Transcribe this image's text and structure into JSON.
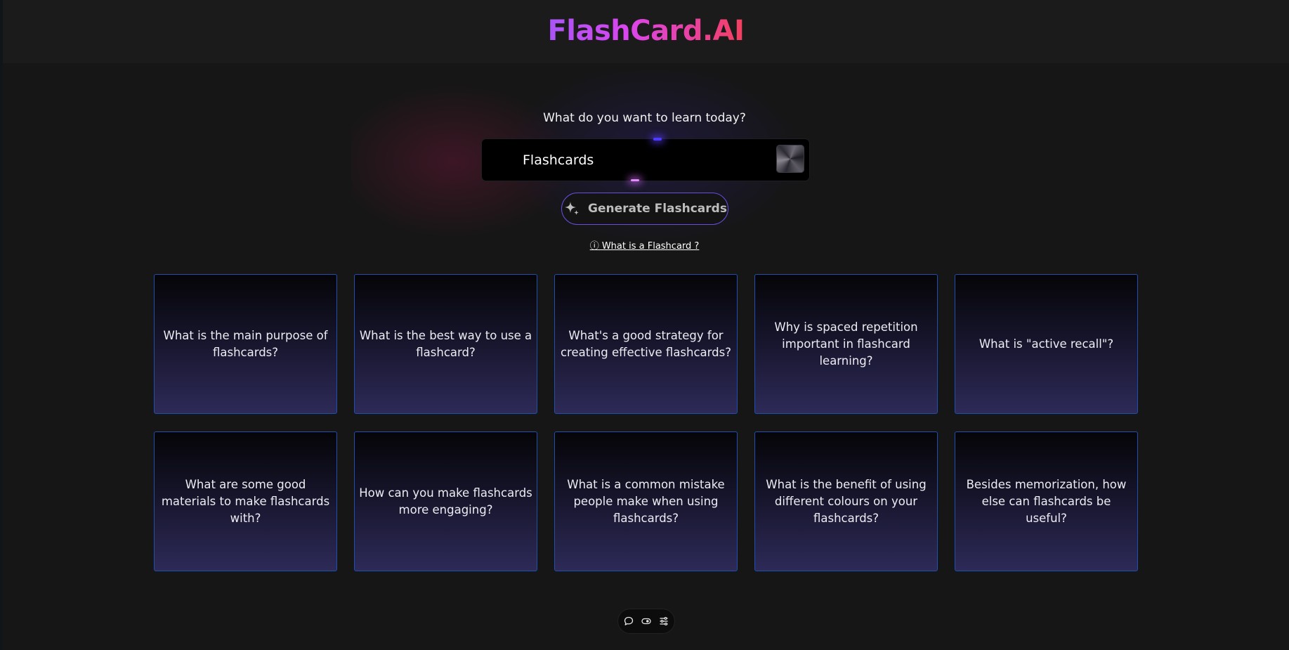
{
  "header": {
    "logo": "FlashCard.AI"
  },
  "hero": {
    "prompt": "What do you want to learn today?",
    "search_value": "Flashcards",
    "generate_label": "Generate Flashcards",
    "info_link": "ⓘ What is a Flashcard ?"
  },
  "cards": [
    {
      "text": "What is the main purpose of flashcards?"
    },
    {
      "text": "What is the best way to use a flashcard?"
    },
    {
      "text": "What's a good strategy for creating effective flashcards?"
    },
    {
      "text": "Why is spaced repetition important in flashcard learning?"
    },
    {
      "text": "What is \"active recall\"?"
    },
    {
      "text": "What are some good materials to make flashcards with?"
    },
    {
      "text": "How can you make flashcards more engaging?"
    },
    {
      "text": "What is a common mistake people make when using flashcards?"
    },
    {
      "text": "What is the benefit of using different colours on your flashcards?"
    },
    {
      "text": "Besides memorization, how else can flashcards be useful?"
    }
  ],
  "toolbar": {
    "icons": [
      "chat-bubble-icon",
      "eye-toggle-icon",
      "settings-sliders-icon"
    ]
  },
  "colors": {
    "background": "#161616",
    "header": "#1b1b1b",
    "card_border": "#1f4fb0",
    "button_border": "#6a4ce0",
    "logo_gradient_start": "#a855f7",
    "logo_gradient_end": "#f43f5e"
  }
}
